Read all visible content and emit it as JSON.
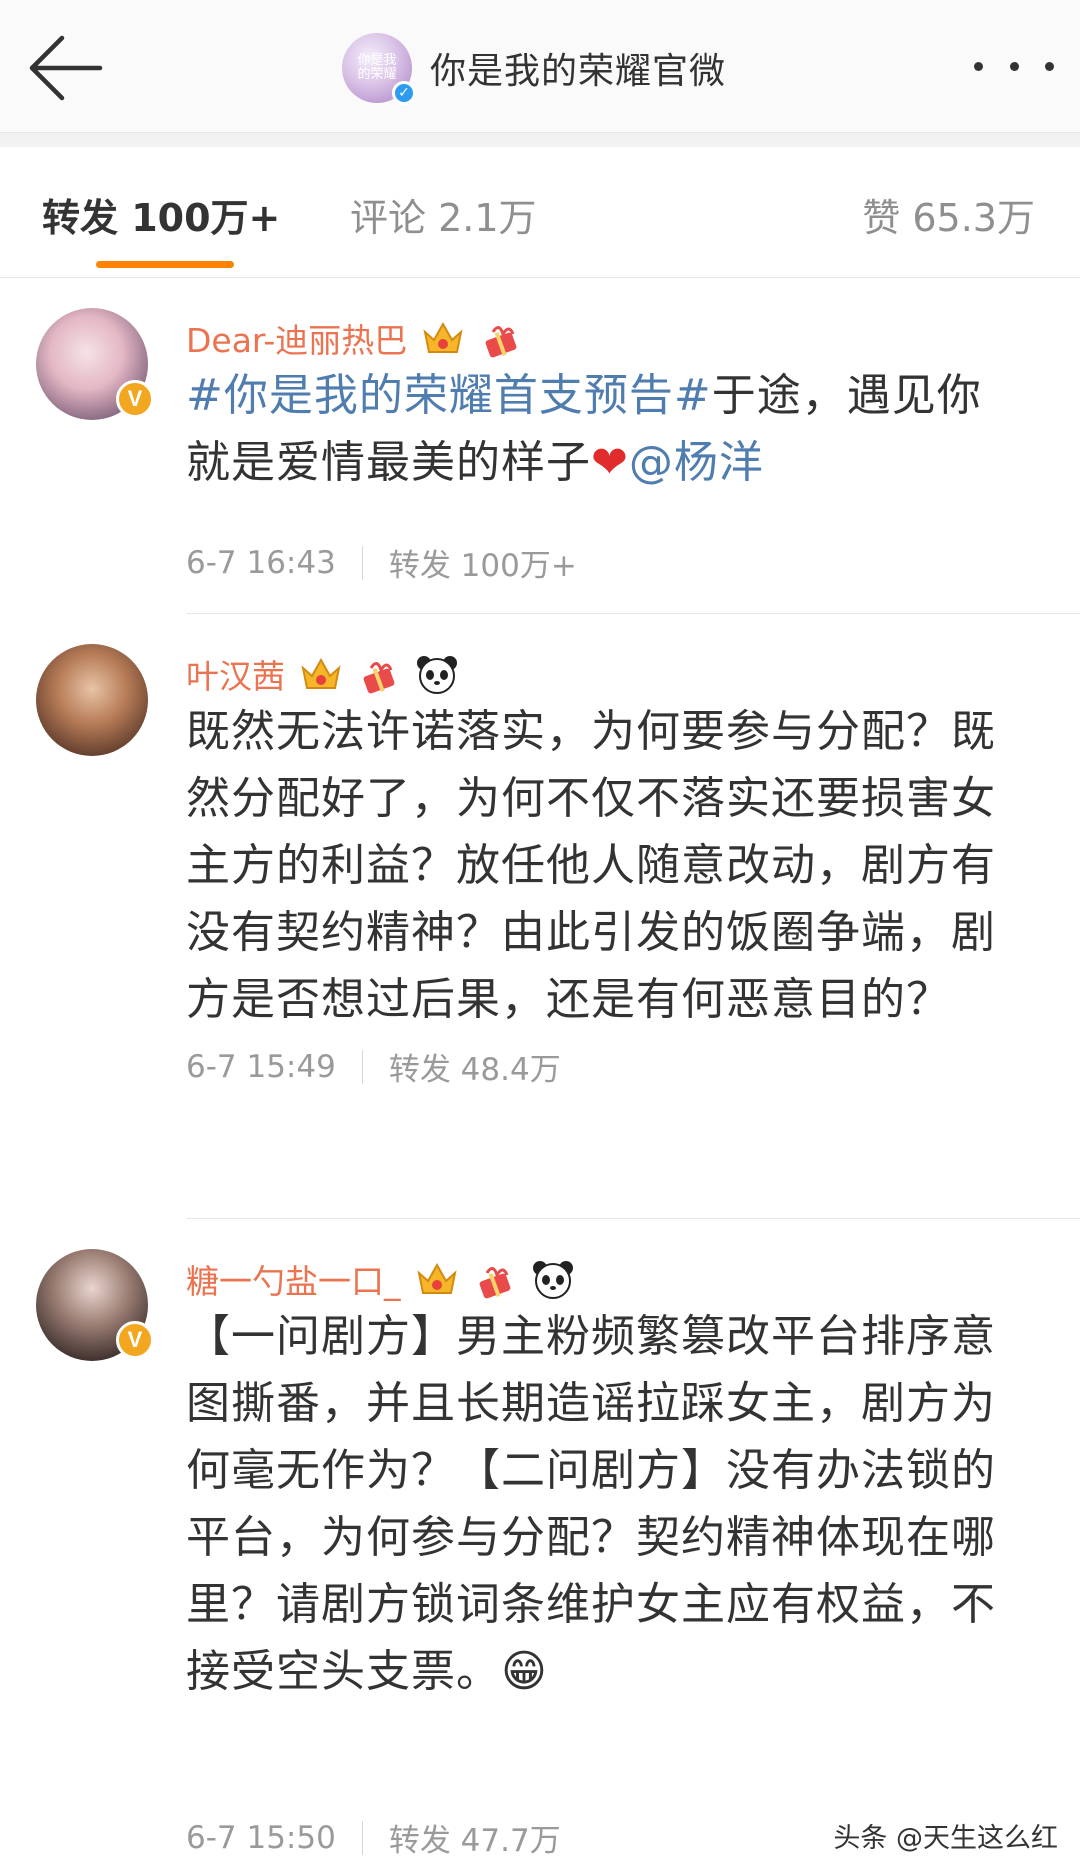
{
  "header": {
    "title": "你是我的荣耀官微",
    "avatar_text": "你是我的荣耀",
    "verified_mark": "✓"
  },
  "tabs": [
    {
      "label": "转发 100万+",
      "active": true
    },
    {
      "label": "评论 2.1万",
      "active": false
    },
    {
      "label": "赞 65.3万",
      "active": false
    }
  ],
  "colors": {
    "accent": "#ff8200",
    "username": "#eb7350",
    "link": "#507daf",
    "vip": "#f3a61f"
  },
  "posts": [
    {
      "username": "Dear-迪丽热巴",
      "badges": [
        "crown-icon",
        "gift-icon"
      ],
      "topic": "#你是我的荣耀首支预告#",
      "text_after_topic": "于途，遇见你就是爱情最美的样子",
      "emoji": "❤",
      "mention": "@杨洋",
      "time": "6-7 16:43",
      "repost": "转发 100万+"
    },
    {
      "username": "叶汉茜",
      "badges": [
        "crown-icon",
        "gift-icon",
        "panda-icon"
      ],
      "text": "既然无法许诺落实，为何要参与分配？既然分配好了，为何不仅不落实还要损害女主方的利益？放任他人随意改动，剧方有没有契约精神？由此引发的饭圈争端，剧方是否想过后果，还是有何恶意目的？",
      "time": "6-7 15:49",
      "repost": "转发 48.4万"
    },
    {
      "username": "糖一勺盐一口_",
      "badges": [
        "crown-icon",
        "gift-icon",
        "panda-icon"
      ],
      "text": "【一问剧方】男主粉频繁篡改平台排序意图撕番，并且长期造谣拉踩女主，剧方为何毫无作为？【二问剧方】没有办法锁的平台，为何参与分配？契约精神体现在哪里？请剧方锁词条维护女主应有权益，不接受空头支票。",
      "emoji": "😁",
      "time": "6-7 15:50",
      "repost": "转发 47.7万"
    }
  ],
  "vip_badge": "V",
  "watermark": "头条 @天生这么红"
}
